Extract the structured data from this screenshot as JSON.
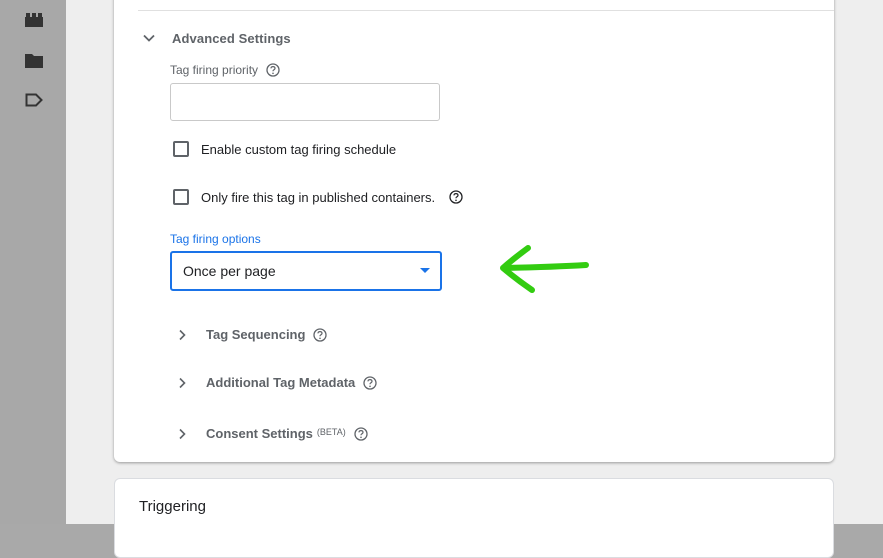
{
  "advanced": {
    "title": "Advanced Settings",
    "priority_label": "Tag firing priority",
    "priority_value": "",
    "custom_schedule_label": "Enable custom tag firing schedule",
    "published_only_label": "Only fire this tag in published containers.",
    "firing_options_label": "Tag firing options",
    "firing_options_value": "Once per page"
  },
  "sections": {
    "tag_sequencing": "Tag Sequencing",
    "additional_metadata": "Additional Tag Metadata",
    "consent_settings": "Consent Settings",
    "consent_badge": "(BETA)"
  },
  "triggering": {
    "title": "Triggering"
  },
  "colors": {
    "accent": "#1a73e8",
    "annotation_arrow": "#33cc11"
  },
  "icons": {
    "rail": [
      "containers-icon",
      "folder-icon",
      "tag-icon"
    ],
    "help": "help-circle-icon"
  }
}
